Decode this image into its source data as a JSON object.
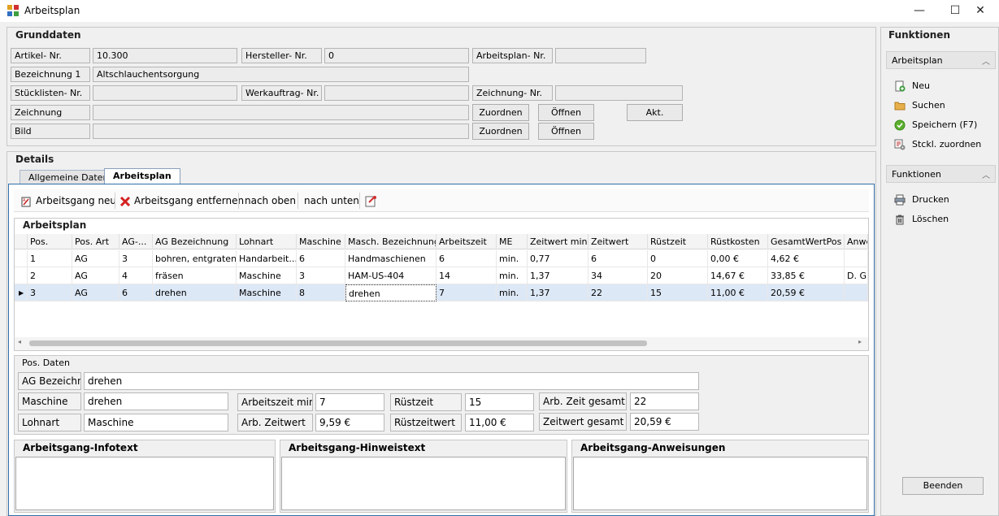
{
  "window": {
    "title": "Arbeitsplan",
    "minimize": "—",
    "maximize": "☐",
    "close": "✕"
  },
  "grunddaten": {
    "title": "Grunddaten",
    "artikel_label": "Artikel- Nr.",
    "artikel_value": "10.300",
    "hersteller_label": "Hersteller- Nr.",
    "hersteller_value": "0",
    "arbeitsplan_label": "Arbeitsplan- Nr.",
    "arbeitsplan_value": "",
    "bezeichnung_label": "Bezeichnung 1",
    "bezeichnung_value": "Altschlauchentsorgung",
    "stueckliste_label": "Stücklisten- Nr.",
    "stueckliste_value": "",
    "werkauftrag_label": "Werkauftrag- Nr.",
    "werkauftrag_value": "",
    "zeichnungnr_label": "Zeichnung- Nr.",
    "zeichnungnr_value": "",
    "zeichnung_label": "Zeichnung",
    "zeichnung_value": "",
    "bild_label": "Bild",
    "bild_value": "",
    "zuordnen": "Zuordnen",
    "oeffnen": "Öffnen",
    "akt": "Akt."
  },
  "details": {
    "title": "Details",
    "tabs": [
      {
        "label": "Allgemeine Daten"
      },
      {
        "label": "Arbeitsplan"
      }
    ],
    "toolbar": {
      "neu": "Arbeitsgang neu",
      "entfernen": "Arbeitsgang entfernen",
      "oben": "nach oben",
      "unten": "nach unten"
    },
    "grid": {
      "title": "Arbeitsplan",
      "columns": [
        "Pos.",
        "Pos. Art",
        "AG-...",
        "AG Bezeichnung",
        "Lohnart",
        "Maschine",
        "Masch. Bezeichnung",
        "Arbeitszeit",
        "ME",
        "Zeitwert min.",
        "Zeitwert",
        "Rüstzeit",
        "Rüstkosten",
        "GesamtWertPos",
        "Anwe"
      ],
      "rows": [
        [
          "1",
          "AG",
          "3",
          "bohren, entgraten",
          "Handarbeit...",
          "6",
          "Handmaschienen",
          "6",
          "min.",
          "0,77",
          "6",
          "0",
          "0,00 €",
          "4,62 €",
          ""
        ],
        [
          "2",
          "AG",
          "4",
          "fräsen",
          "Maschine",
          "3",
          "HAM-US-404",
          "14",
          "min.",
          "1,37",
          "34",
          "20",
          "14,67 €",
          "33,85 €",
          "D. Gr"
        ],
        [
          "3",
          "AG",
          "6",
          "drehen",
          "Maschine",
          "8",
          "drehen",
          "7",
          "min.",
          "1,37",
          "22",
          "15",
          "11,00 €",
          "20,59 €",
          ""
        ]
      ]
    },
    "pos": {
      "title": "Pos. Daten",
      "ag_label": "AG Bezeichn",
      "ag_value": "drehen",
      "maschine_label": "Maschine",
      "maschine_value": "drehen",
      "lohnart_label": "Lohnart",
      "lohnart_value": "Maschine",
      "az_label": "Arbeitszeit min",
      "az_value": "7",
      "azw_label": "Arb. Zeitwert",
      "azw_value": "9,59 €",
      "rz_label": "Rüstzeit",
      "rz_value": "15",
      "rzw_label": "Rüstzeitwert",
      "rzw_value": "11,00 €",
      "azg_label": "Arb. Zeit gesamt",
      "azg_value": "22",
      "zwg_label": "Zeitwert gesamt",
      "zwg_value": "20,59 €"
    },
    "memos": {
      "info": "Arbeitsgang-Infotext",
      "hinweis": "Arbeitsgang-Hinweistext",
      "anweisungen": "Arbeitsgang-Anweisungen"
    }
  },
  "funktionen": {
    "title": "Funktionen",
    "section1": "Arbeitsplan",
    "neu": "Neu",
    "suchen": "Suchen",
    "speichern": "Speichern (F7)",
    "stckl": "Stckl. zuordnen",
    "section2": "Funktionen",
    "drucken": "Drucken",
    "loeschen": "Löschen",
    "beenden": "Beenden"
  }
}
